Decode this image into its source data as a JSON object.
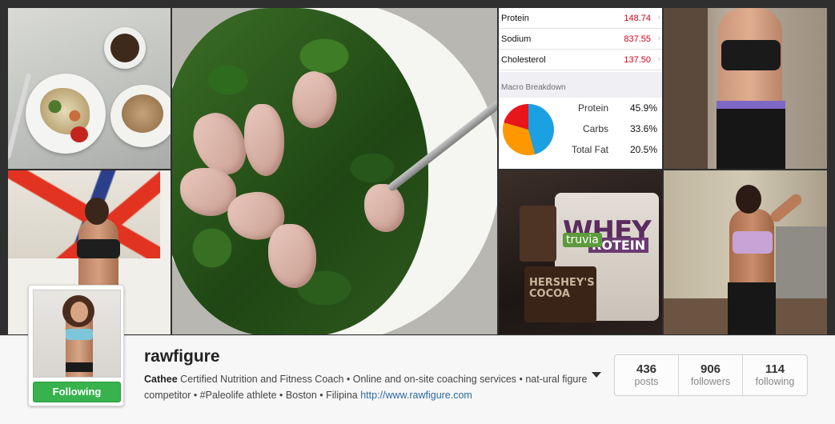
{
  "profile": {
    "username": "rawfigure",
    "follow_button": "Following",
    "bio_name": "Cathee",
    "bio_text": " Certified Nutrition and Fitness Coach • Online and on-site coaching services • nat-ural figure competitor • #Paleolife athlete • Boston • Filipina ",
    "bio_link": "http://www.rawfigure.com"
  },
  "stats": [
    {
      "value": "436",
      "label": "posts"
    },
    {
      "value": "906",
      "label": "followers"
    },
    {
      "value": "114",
      "label": "following"
    }
  ],
  "nutrition": {
    "rows": [
      {
        "label": "Protein",
        "value": "148.74"
      },
      {
        "label": "Sodium",
        "value": "837.55"
      },
      {
        "label": "Cholesterol",
        "value": "137.50"
      }
    ],
    "macro_title": "Macro Breakdown",
    "macros": [
      {
        "label": "Protein",
        "value": "45.9%",
        "percent": 45.9,
        "color": "#1ba1e2"
      },
      {
        "label": "Carbs",
        "value": "33.6%",
        "percent": 33.6,
        "color": "#ff9800"
      },
      {
        "label": "Total Fat",
        "value": "20.5%",
        "percent": 20.5,
        "color": "#e8151b"
      }
    ]
  },
  "photo_text": {
    "whey": "WHEY",
    "protein": "ROTEIN",
    "truvia": "truvia",
    "cocoa": "HERSHEY'S COCOA"
  },
  "colors": {
    "follow_green": "#37b24d",
    "link_blue": "#2c6aa0",
    "value_red": "#d0021b"
  },
  "icons": {
    "dropdown": "chevron-down-icon",
    "row_arrow": "chevron-right-icon"
  }
}
